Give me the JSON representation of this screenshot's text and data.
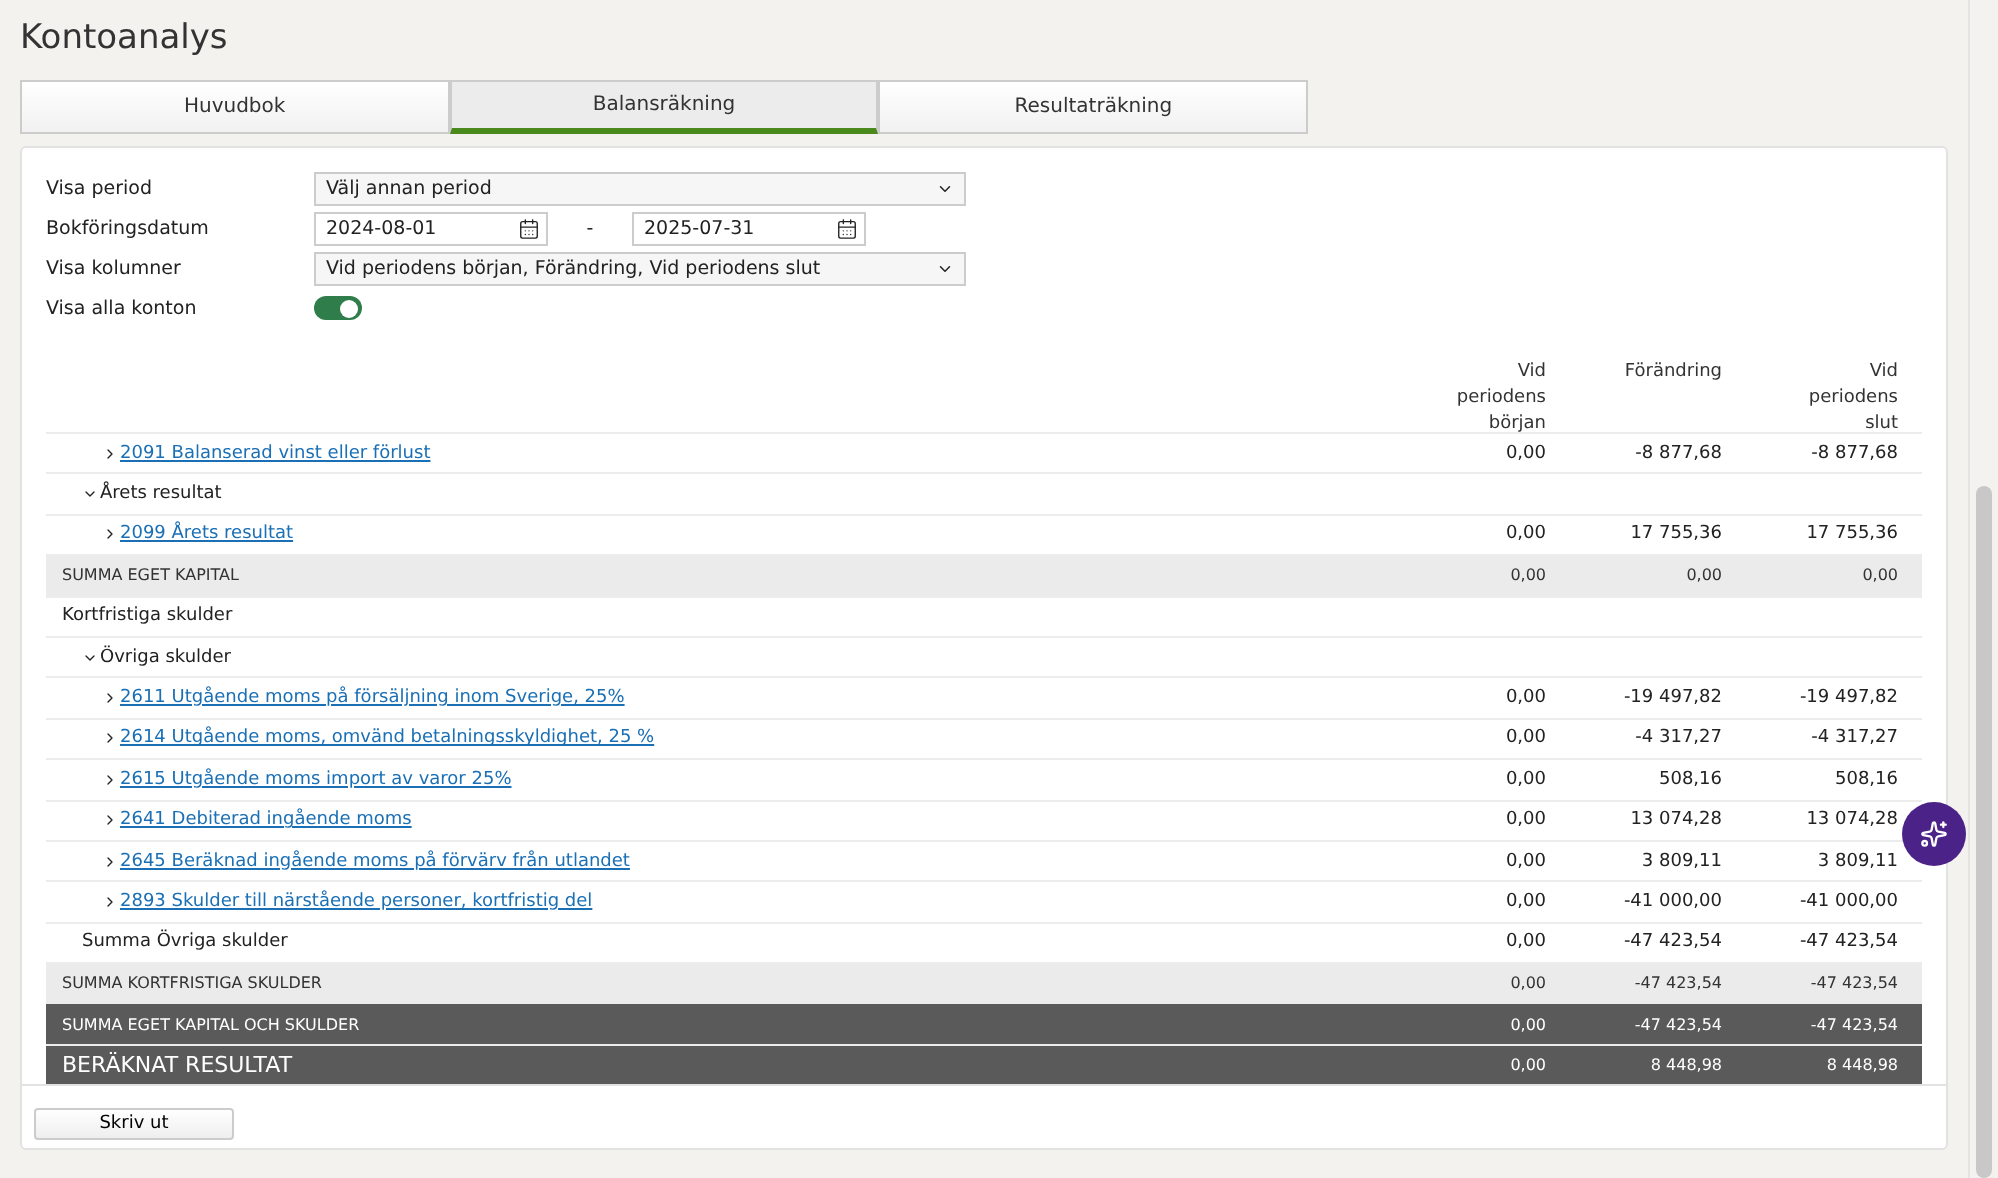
{
  "title": "Kontoanalys",
  "tabs": [
    {
      "label": "Huvudbok",
      "selected": false
    },
    {
      "label": "Balansräkning",
      "selected": true
    },
    {
      "label": "Resultaträkning",
      "selected": false
    }
  ],
  "form": {
    "period": {
      "label": "Visa period",
      "value": "Välj annan period"
    },
    "date": {
      "label": "Bokföringsdatum",
      "from": "2024-08-01",
      "separator": "-",
      "to": "2025-07-31"
    },
    "columns": {
      "label": "Visa kolumner",
      "value": "Vid periodens början, Förändring, Vid periodens slut"
    },
    "all_accounts": {
      "label": "Visa alla konton",
      "on": true
    }
  },
  "table": {
    "columns": [
      "Vid periodens början",
      "Förändring",
      "Vid periodens slut"
    ],
    "rows": [
      {
        "kind": "account",
        "label": "2091 Balanserad vinst eller förlust",
        "expanded": false,
        "values": [
          "0,00",
          "-8 877,68",
          "-8 877,68"
        ]
      },
      {
        "kind": "group",
        "label": "Årets resultat",
        "expanded": true,
        "children": [
          {
            "kind": "account",
            "label": "2099 Årets resultat",
            "expanded": false,
            "values": [
              "0,00",
              "17 755,36",
              "17 755,36"
            ]
          }
        ]
      },
      {
        "kind": "summary",
        "label": "SUMMA EGET KAPITAL",
        "values": [
          "0,00",
          "0,00",
          "0,00"
        ]
      },
      {
        "kind": "section",
        "label": "Kortfristiga skulder",
        "children": [
          {
            "kind": "group",
            "label": "Övriga skulder",
            "expanded": true,
            "children": [
              {
                "kind": "account",
                "label": "2611 Utgående moms på försäljning inom Sverige, 25%",
                "expanded": false,
                "values": [
                  "0,00",
                  "-19 497,82",
                  "-19 497,82"
                ]
              },
              {
                "kind": "account",
                "label": "2614 Utgående moms, omvänd betalningsskyldighet, 25 %",
                "expanded": false,
                "values": [
                  "0,00",
                  "-4 317,27",
                  "-4 317,27"
                ]
              },
              {
                "kind": "account",
                "label": "2615 Utgående moms import av varor 25%",
                "expanded": false,
                "values": [
                  "0,00",
                  "508,16",
                  "508,16"
                ]
              },
              {
                "kind": "account",
                "label": "2641 Debiterad ingående moms",
                "expanded": false,
                "values": [
                  "0,00",
                  "13 074,28",
                  "13 074,28"
                ]
              },
              {
                "kind": "account",
                "label": "2645 Beräknad ingående moms på förvärv från utlandet",
                "expanded": false,
                "values": [
                  "0,00",
                  "3 809,11",
                  "3 809,11"
                ]
              },
              {
                "kind": "account",
                "label": "2893 Skulder till närstående personer, kortfristig del",
                "expanded": false,
                "values": [
                  "0,00",
                  "-41 000,00",
                  "-41 000,00"
                ]
              }
            ]
          },
          {
            "kind": "subtotal",
            "label": "Summa Övriga skulder",
            "values": [
              "0,00",
              "-47 423,54",
              "-47 423,54"
            ]
          }
        ]
      },
      {
        "kind": "summary",
        "label": "SUMMA KORTFRISTIGA SKULDER",
        "values": [
          "0,00",
          "-47 423,54",
          "-47 423,54"
        ]
      },
      {
        "kind": "total",
        "label": "SUMMA EGET KAPITAL OCH SKULDER",
        "values": [
          "0,00",
          "-47 423,54",
          "-47 423,54"
        ]
      },
      {
        "kind": "result",
        "label": "BERÄKNAT RESULTAT",
        "values": [
          "0,00",
          "8 448,98",
          "8 448,98"
        ]
      }
    ]
  },
  "print_button": "Skriv ut"
}
